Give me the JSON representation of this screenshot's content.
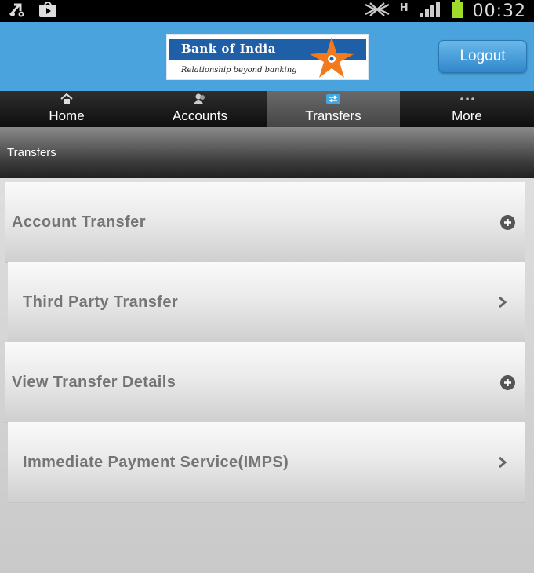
{
  "status_bar": {
    "time": "00:32",
    "network_type": "H",
    "icons": [
      "usb-icon",
      "store-icon",
      "data-icon",
      "signal-icon",
      "battery-icon"
    ]
  },
  "header": {
    "logo": {
      "name": "Bank of India",
      "tagline": "Relationship beyond banking"
    },
    "logout_label": "Logout",
    "color": "#4aa3dc"
  },
  "nav": {
    "tabs": [
      {
        "label": "Home",
        "icon": "home-icon"
      },
      {
        "label": "Accounts",
        "icon": "accounts-icon"
      },
      {
        "label": "Transfers",
        "icon": "transfers-icon",
        "active": true
      },
      {
        "label": "More",
        "icon": "more-icon"
      }
    ]
  },
  "page": {
    "title": "Transfers"
  },
  "list": {
    "items": [
      {
        "label": "Account Transfer",
        "icon": "plus-circle-icon"
      },
      {
        "label": "Third Party Transfer",
        "icon": "chevron-right-icon"
      },
      {
        "label": "View Transfer Details",
        "icon": "plus-circle-icon"
      },
      {
        "label": "Immediate Payment Service(IMPS)",
        "icon": "chevron-right-icon"
      }
    ]
  }
}
